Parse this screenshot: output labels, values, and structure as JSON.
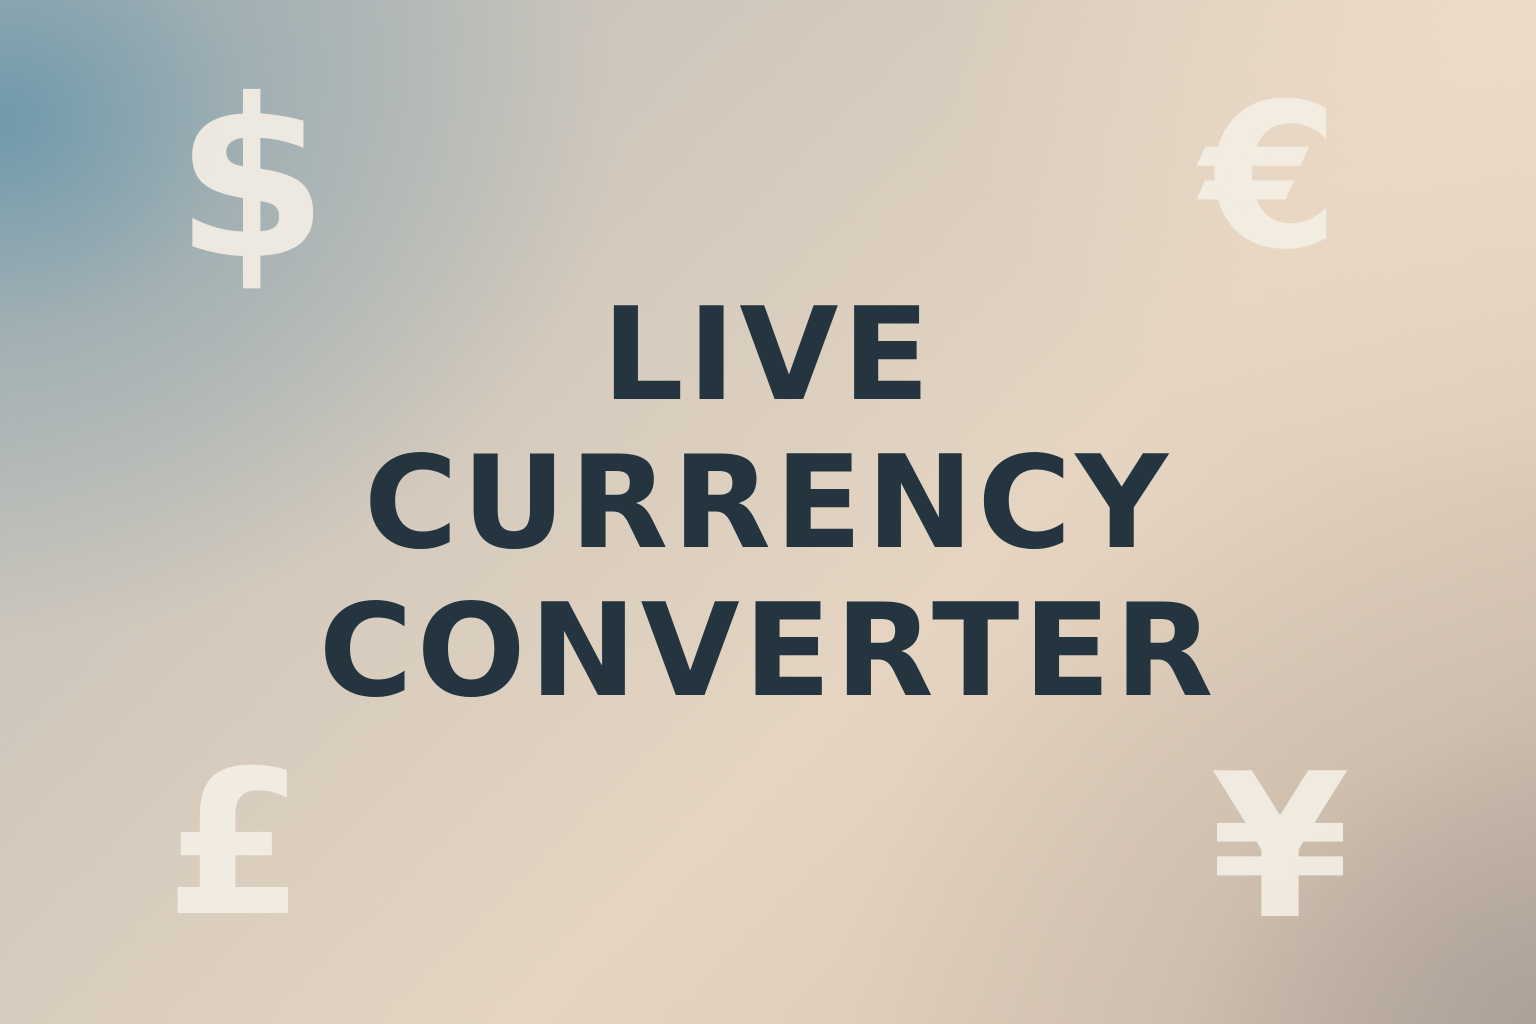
{
  "title": {
    "lines": [
      "LIVE",
      "CURRENCY",
      "CONVERTER"
    ]
  },
  "symbols": {
    "dollar": "$",
    "euro": "€",
    "pound": "£",
    "yen": "¥"
  },
  "colors": {
    "title": "#243540",
    "symbols": "#f4eee4",
    "gradient_top_left": "#6896aa",
    "gradient_center": "#e7d6c2"
  }
}
